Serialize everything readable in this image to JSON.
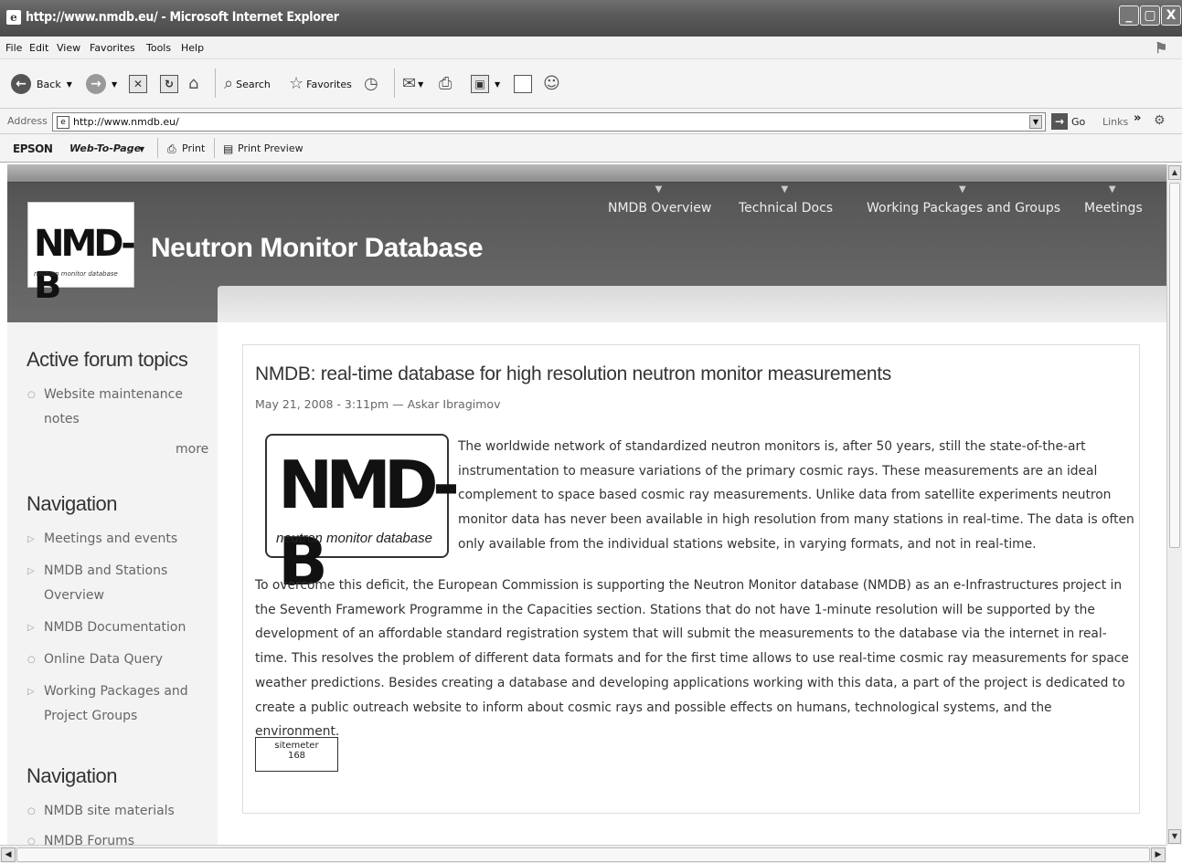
{
  "window": {
    "title": "http://www.nmdb.eu/ - Microsoft Internet Explorer",
    "min_label": "_",
    "max_label": "▢",
    "close_label": "X"
  },
  "menu": [
    "File",
    "Edit",
    "View",
    "Favorites",
    "Tools",
    "Help"
  ],
  "toolbar": {
    "back_label": "Back",
    "search_label": "Search",
    "favorites_label": "Favorites"
  },
  "address": {
    "label": "Address",
    "url": "http://www.nmdb.eu/",
    "go_label": "Go",
    "links_label": "Links",
    "chevron": "»"
  },
  "epson": {
    "brand": "EPSON",
    "web_to_page": "Web-To-Page",
    "print_label": "Print",
    "print_preview_label": "Print Preview"
  },
  "site": {
    "logo_text": "NMD-B",
    "logo_sub": "neutron monitor database",
    "name": "Neutron Monitor Database",
    "nav": [
      "NMDB Overview",
      "Technical Docs",
      "Working Packages and Groups",
      "Meetings"
    ]
  },
  "sidebar": {
    "forum_heading": "Active forum topics",
    "forum_items": [
      "Website maintenance notes"
    ],
    "more_label": "more",
    "nav1_heading": "Navigation",
    "nav1_items": [
      "Meetings and events",
      "NMDB and Stations Overview",
      "NMDB Documentation",
      "Online Data Query",
      "Working Packages and Project Groups"
    ],
    "nav2_heading": "Navigation",
    "nav2_items": [
      "NMDB site materials",
      "NMDB Forums"
    ]
  },
  "article": {
    "title": "NMDB: real-time database for high resolution neutron monitor measurements",
    "meta": "May 21, 2008 - 3:11pm — Askar Ibragimov",
    "para1": "The worldwide network of standardized neutron monitors is, after 50 years, still the state-of-the-art instrumentation to measure variations of the primary cosmic rays. These measurements are an ideal complement to space based cosmic ray measurements. Unlike data from satellite experiments neutron monitor data has never been available in high resolution from many stations in real-time. The data is often only available from the individual stations website, in varying formats, and not in real-time.",
    "para2": "To overcome this deficit, the European Commission is supporting the Neutron Monitor database (NMDB) as an e-Infrastructures project in the Seventh Framework Programme in the Capacities section. Stations that do not have 1-minute resolution will be supported by the development of an affordable standard registration system that will submit the measurements to the database via the internet in real-time. This resolves the problem of different data formats and for the first time allows to use real-time cosmic ray measurements for space weather predictions. Besides creating a database and developing applications working with this data, a part of the project is dedicated to create a public outreach website to inform about cosmic rays and possible effects on humans, technological systems, and the environment.",
    "sitemeter_label": "sitemeter",
    "sitemeter_count": "168"
  }
}
